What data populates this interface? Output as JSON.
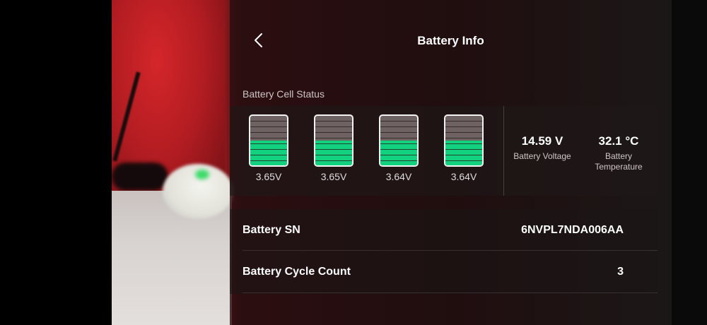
{
  "header": {
    "title": "Battery Info"
  },
  "cells_section": {
    "label": "Battery Cell Status",
    "cells": [
      {
        "voltage": "3.65V",
        "fill_fraction": 0.5
      },
      {
        "voltage": "3.65V",
        "fill_fraction": 0.5
      },
      {
        "voltage": "3.64V",
        "fill_fraction": 0.5
      },
      {
        "voltage": "3.64V",
        "fill_fraction": 0.5
      }
    ],
    "voltage": {
      "value": "14.59 V",
      "label": "Battery Voltage"
    },
    "temperature": {
      "value": "32.1 °C",
      "label": "Battery Temperature"
    }
  },
  "info": {
    "serial": {
      "label": "Battery SN",
      "value": "6NVPL7NDA006AA"
    },
    "cycles": {
      "label": "Battery Cycle Count",
      "value": "3"
    }
  },
  "colors": {
    "cell_fill": "#12d27f",
    "cell_empty": "#6f6262"
  }
}
